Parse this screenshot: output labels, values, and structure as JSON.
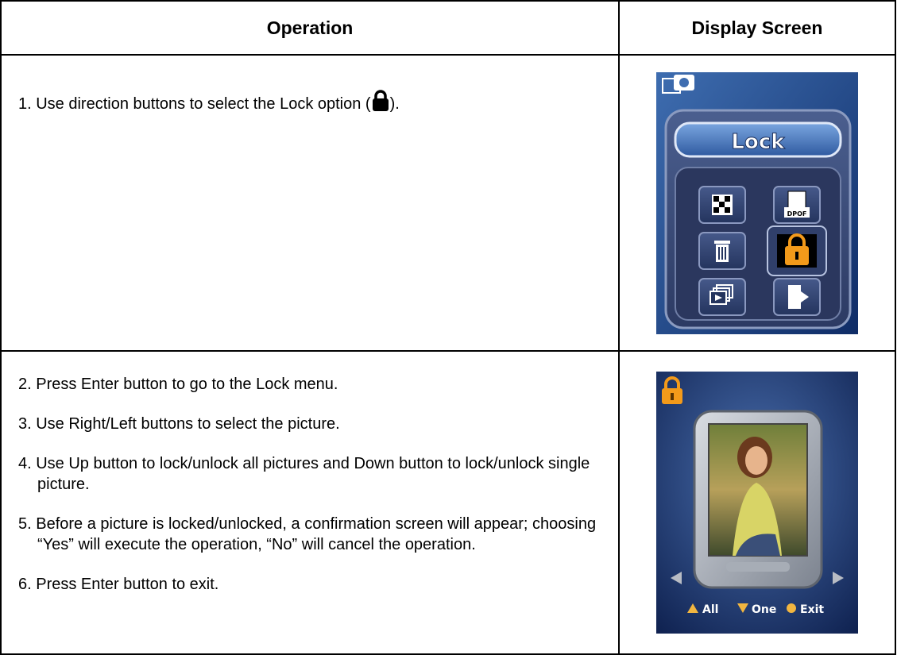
{
  "headers": {
    "operation": "Operation",
    "display": "Display Screen"
  },
  "row1": {
    "step1_pre": "1. Use direction buttons to select the Lock option (",
    "step1_post": ")."
  },
  "row2": {
    "steps": [
      "2. Press Enter button to go to the Lock menu.",
      "3. Use Right/Left buttons to select the picture.",
      "4. Use Up button to lock/unlock all pictures and Down button to lock/unlock single picture.",
      "5. Before a picture is locked/unlocked, a confirmation screen will appear; choosing “Yes” will execute the operation, “No” will cancel the operation.",
      "6. Press Enter button to exit."
    ]
  },
  "screen1": {
    "title": "Lock",
    "selected_icon": "lock-icon",
    "icons": [
      "slideshow-icon",
      "dpof-icon",
      "trash-icon",
      "lock-icon",
      "thumbnail-icon",
      "exit-icon"
    ],
    "dpof_text": "DPOF"
  },
  "screen2": {
    "hint_all": "All",
    "hint_one": "One",
    "hint_exit": "Exit"
  },
  "colors": {
    "accent": "#f39a1a",
    "menu_blue": "#2a4b86",
    "bg_blue": "#1c3f7e"
  }
}
